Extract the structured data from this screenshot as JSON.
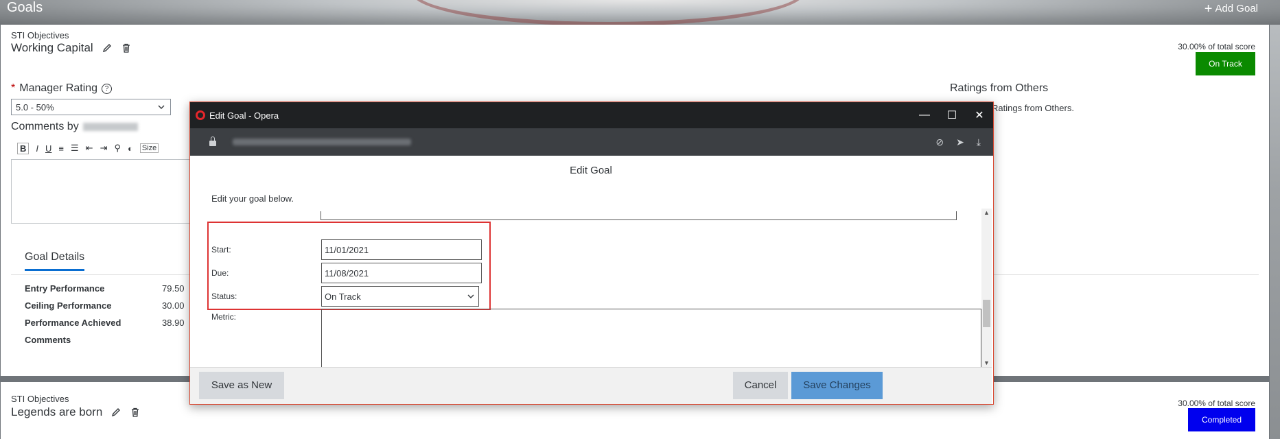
{
  "header": {
    "title": "Goals",
    "add_goal": "Add Goal"
  },
  "goals": [
    {
      "category": "STI Objectives",
      "title": "Working Capital",
      "score_text": "30.00% of total score",
      "status": "On Track",
      "status_color": "#0a8a00",
      "manager_rating_label": "Manager Rating",
      "manager_rating_value": "5.0 - 50%",
      "comments_label": "Comments by",
      "ratings_from_others_title": "Ratings from Others",
      "ratings_from_others_text": "Ratings from Others.",
      "rte_toolbar": {
        "size": "Size"
      },
      "tab": "Goal Details",
      "details": [
        {
          "label": "Entry Performance",
          "value": "79.50"
        },
        {
          "label": "Ceiling Performance",
          "value": "30.00"
        },
        {
          "label": "Performance Achieved",
          "value": "38.90"
        },
        {
          "label": "Comments",
          "value": ""
        }
      ]
    },
    {
      "category": "STI Objectives",
      "title": "Legends are born",
      "score_text": "30.00% of total score",
      "status": "Completed",
      "status_color": "#0000ee"
    }
  ],
  "window": {
    "title": "Edit Goal - Opera"
  },
  "dialog": {
    "heading": "Edit Goal",
    "intro": "Edit your goal below.",
    "start_label": "Start:",
    "start_value": "11/01/2021",
    "due_label": "Due:",
    "due_value": "11/08/2021",
    "status_label": "Status:",
    "status_value": "On Track",
    "metric_label": "Metric:",
    "save_as_new": "Save as New",
    "cancel": "Cancel",
    "save_changes": "Save Changes"
  }
}
